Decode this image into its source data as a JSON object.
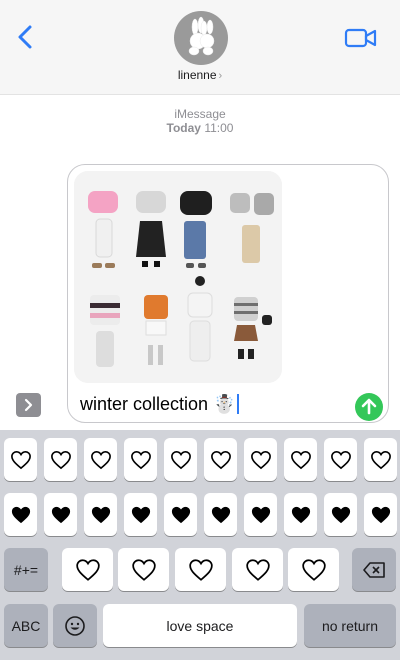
{
  "header": {
    "contact_name": "linenne",
    "contact_chevron": "›",
    "back_icon": "chevron-left-icon",
    "video_icon": "video-camera-icon",
    "accent_color": "#2f7cf6"
  },
  "timestamp": {
    "service": "iMessage",
    "day": "Today",
    "time": "11:00"
  },
  "compose": {
    "text": "winter collection",
    "emoji": "☃️",
    "send_icon": "arrow-up-icon",
    "send_color": "#34c759",
    "apps_icon": "chevron-right-icon"
  },
  "keyboard": {
    "row1": [
      "♡",
      "♡",
      "♡",
      "♡",
      "♡",
      "♡",
      "♡",
      "♡",
      "♡",
      "♡"
    ],
    "row2": [
      "♥",
      "♥",
      "♥",
      "♥",
      "♥",
      "♥",
      "♥",
      "♥",
      "♥",
      "♥"
    ],
    "row3": [
      "♡",
      "♡",
      "♡",
      "♡",
      "♡"
    ],
    "symbols_label": "#+=",
    "delete_icon": "backspace-icon",
    "abc_label": "ABC",
    "emoji_icon": "emoji-icon",
    "space_label": "love space",
    "return_label": "no return"
  }
}
